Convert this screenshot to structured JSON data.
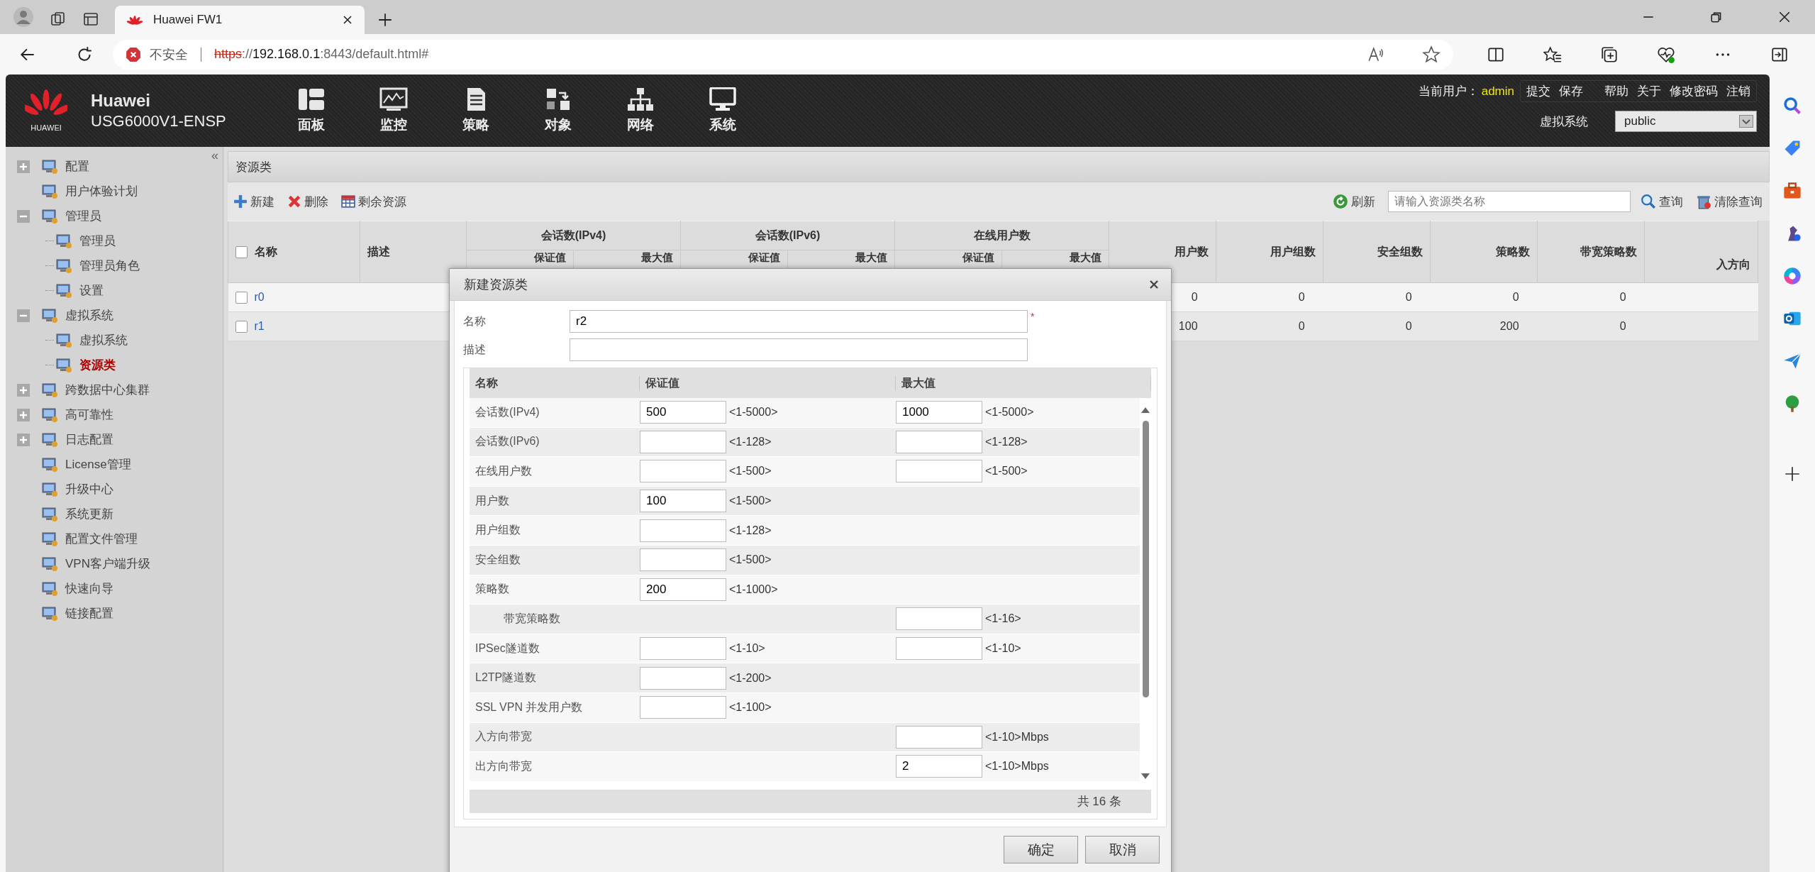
{
  "browser": {
    "tab_title": "Huawei FW1",
    "security": "不安全",
    "url": [
      {
        "text": "https",
        "kind": "scheme"
      },
      {
        "text": "://",
        "kind": "dim"
      },
      {
        "text": "192.168.0.1",
        "kind": "host"
      },
      {
        "text": ":8443/default.html#",
        "kind": "dim"
      }
    ]
  },
  "header": {
    "logo_text": "HUAWEI",
    "brand": "Huawei",
    "model": "USG6000V1-ENSP",
    "nav": [
      {
        "label": "面板"
      },
      {
        "label": "监控"
      },
      {
        "label": "策略"
      },
      {
        "label": "对象"
      },
      {
        "label": "网络"
      },
      {
        "label": "系统"
      }
    ],
    "user_label": "当前用户：",
    "user": "admin",
    "links": [
      "提交",
      "保存",
      "帮助",
      "关于",
      "修改密码",
      "注销"
    ],
    "vsys_label": "虚拟系统",
    "vsys_value": "public"
  },
  "sidebar": {
    "collapse": "«",
    "items": [
      {
        "label": "配置",
        "expanded": false,
        "selected": false
      },
      {
        "label": "用户体验计划",
        "selected": false
      },
      {
        "label": "管理员",
        "expanded": true,
        "selected": false,
        "children": [
          {
            "label": "管理员",
            "selected": false
          },
          {
            "label": "管理员角色",
            "selected": false
          },
          {
            "label": "设置",
            "selected": false
          }
        ]
      },
      {
        "label": "虚拟系统",
        "expanded": true,
        "selected": false,
        "children": [
          {
            "label": "虚拟系统",
            "selected": false
          },
          {
            "label": "资源类",
            "selected": true
          }
        ]
      },
      {
        "label": "跨数据中心集群",
        "expanded": false,
        "selected": false
      },
      {
        "label": "高可靠性",
        "expanded": false,
        "selected": false
      },
      {
        "label": "日志配置",
        "expanded": false,
        "selected": false
      },
      {
        "label": "License管理",
        "selected": false
      },
      {
        "label": "升级中心",
        "selected": false
      },
      {
        "label": "系统更新",
        "selected": false
      },
      {
        "label": "配置文件管理",
        "selected": false
      },
      {
        "label": "VPN客户端升级",
        "selected": false
      },
      {
        "label": "快速向导",
        "selected": false
      },
      {
        "label": "链接配置",
        "selected": false
      }
    ]
  },
  "panel": {
    "title": "资源类",
    "actions": [
      "新建",
      "删除",
      "剩余资源"
    ],
    "refresh": "刷新",
    "search_placeholder": "请输入资源类名称",
    "query": "查询",
    "clear": "清除查询"
  },
  "table": {
    "header_checked": false,
    "columns": [
      {
        "label": "名称"
      },
      {
        "label": "描述"
      },
      {
        "label": "会话数(IPv4)",
        "sub": [
          "保证值",
          "最大值"
        ]
      },
      {
        "label": "会话数(IPv6)",
        "sub": [
          "保证值",
          "最大值"
        ]
      },
      {
        "label": "在线用户数",
        "sub": [
          "保证值",
          "最大值"
        ]
      },
      {
        "label": "用户数"
      },
      {
        "label": "用户组数"
      },
      {
        "label": "安全组数"
      },
      {
        "label": "策略数"
      },
      {
        "label": "带宽策略数"
      },
      {
        "label": "入方向"
      }
    ],
    "rows": [
      {
        "name": "r0",
        "checked": false,
        "cells": [
          "0",
          "0",
          "0",
          "0",
          "0"
        ]
      },
      {
        "name": "r1",
        "checked": false,
        "cells": [
          "100",
          "0",
          "0",
          "200",
          "0"
        ]
      }
    ]
  },
  "dialog": {
    "title": "新建资源类",
    "name_label": "名称",
    "name_value": "r2",
    "required_mark": "*",
    "desc_label": "描述",
    "grid_columns": [
      "名称",
      "保证值",
      "最大值"
    ],
    "rows": [
      {
        "label": "会话数(IPv4)",
        "guarantee": {
          "value": "500",
          "range": "<1-5000>"
        },
        "max": {
          "value": "1000",
          "range": "<1-5000>"
        }
      },
      {
        "label": "会话数(IPv6)",
        "guarantee": {
          "range": "<1-128>"
        },
        "max": {
          "range": "<1-128>"
        }
      },
      {
        "label": "在线用户数",
        "guarantee": {
          "range": "<1-500>"
        },
        "max": {
          "range": "<1-500>"
        }
      },
      {
        "label": "用户数",
        "guarantee": {
          "value": "100",
          "range": "<1-500>"
        }
      },
      {
        "label": "用户组数",
        "guarantee": {
          "range": "<1-128>"
        }
      },
      {
        "label": "安全组数",
        "guarantee": {
          "range": "<1-500>"
        }
      },
      {
        "label": "策略数",
        "guarantee": {
          "value": "200",
          "range": "<1-1000>"
        }
      },
      {
        "label": "带宽策略数",
        "indent": true,
        "max": {
          "range": "<1-16>"
        }
      },
      {
        "label": "IPSec隧道数",
        "guarantee": {
          "range": "<1-10>"
        },
        "max": {
          "range": "<1-10>"
        }
      },
      {
        "label": "L2TP隧道数",
        "guarantee": {
          "range": "<1-200>"
        }
      },
      {
        "label": "SSL VPN 并发用户数",
        "guarantee": {
          "range": "<1-100>"
        }
      },
      {
        "label": "入方向带宽",
        "max": {
          "range": "<1-10>Mbps"
        }
      },
      {
        "label": "出方向带宽",
        "max": {
          "value": "2",
          "range": "<1-10>Mbps"
        }
      }
    ],
    "total": "共 16 条",
    "buttons": [
      "确定",
      "取消"
    ]
  }
}
